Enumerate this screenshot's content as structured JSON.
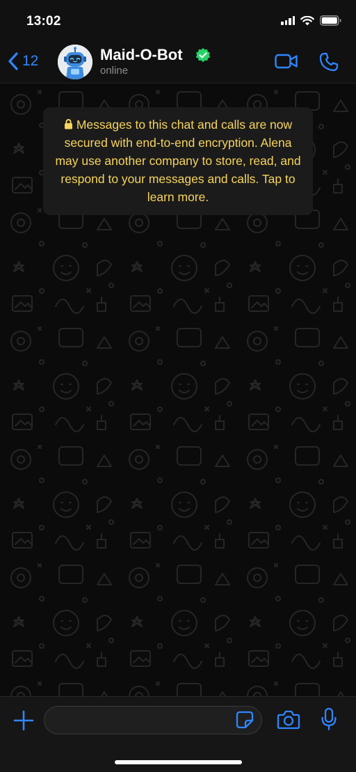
{
  "status_bar": {
    "time": "13:02"
  },
  "header": {
    "back_count": "12",
    "contact_name": "Maid-O-Bot",
    "contact_status": "online",
    "verified": true
  },
  "chat": {
    "encryption_notice": "Messages to this chat and calls are now secured with end-to-end encryption. Alena may use another company to store, read, and respond to your messages and calls. Tap to learn more."
  },
  "input_bar": {
    "message_value": "",
    "message_placeholder": ""
  },
  "icons": {
    "back": "chevron-left-icon",
    "video": "video-camera-icon",
    "call": "phone-icon",
    "plus": "plus-icon",
    "sticker": "sticker-icon",
    "camera": "camera-icon",
    "mic": "microphone-icon",
    "lock": "lock-icon"
  },
  "colors": {
    "accent": "#2f86ff",
    "notice_text": "#f7d45c",
    "verified": "#25d366",
    "background": "#0b0b0b"
  }
}
